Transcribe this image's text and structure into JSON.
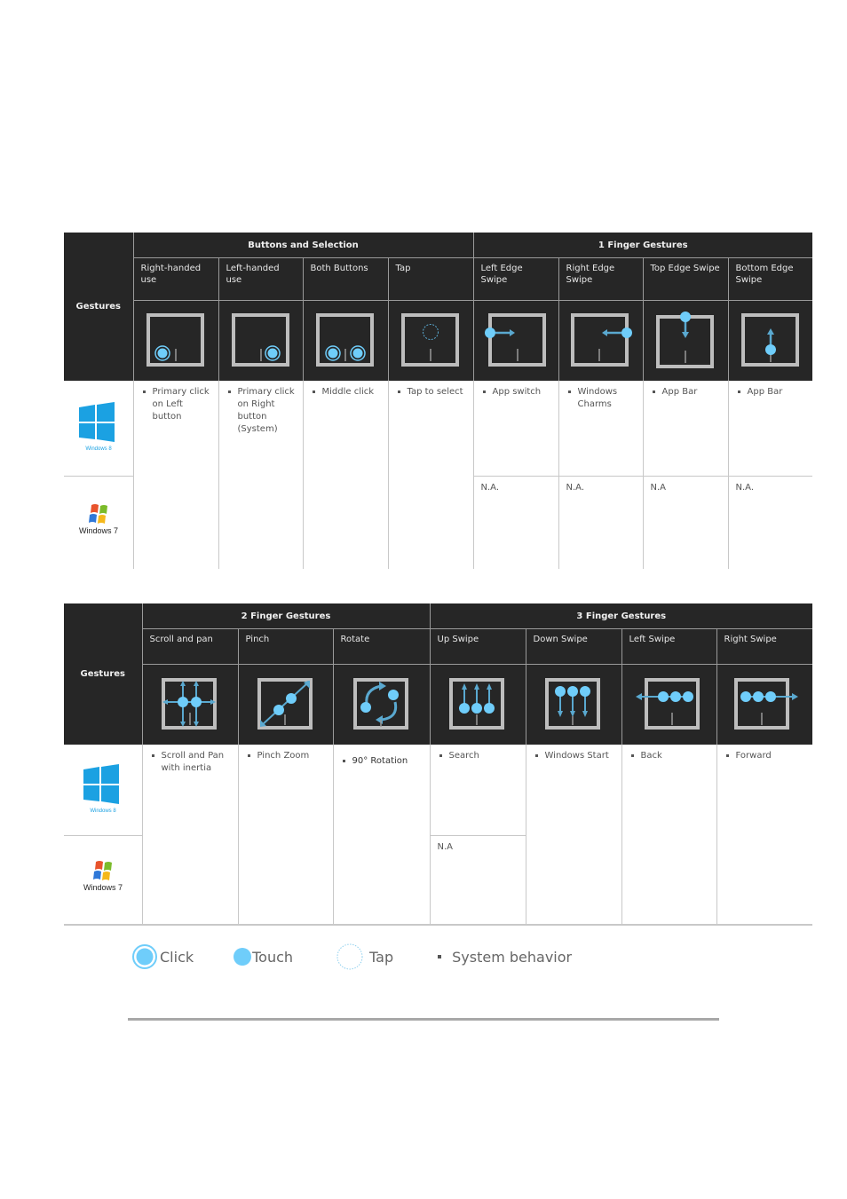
{
  "table1": {
    "row_label": "Gestures",
    "groups": [
      {
        "title": "Buttons and Selection",
        "span": 4
      },
      {
        "title": "1 Finger Gestures",
        "span": 4
      }
    ],
    "columns": [
      {
        "label": "Right-handed use",
        "icon": "right-handed-click-icon",
        "win8": "Primary click on Left button",
        "win7": null
      },
      {
        "label": "Left-handed use",
        "icon": "left-handed-click-icon",
        "win8": "Primary click on Right button (System)",
        "win7": null
      },
      {
        "label": "Both Buttons",
        "icon": "both-buttons-click-icon",
        "win8": "Middle click",
        "win7": null
      },
      {
        "label": "Tap",
        "icon": "tap-icon",
        "win8": "Tap to select",
        "win7": null
      },
      {
        "label": "Left Edge Swipe",
        "icon": "left-edge-swipe-icon",
        "win8": "App switch",
        "win7": "N.A."
      },
      {
        "label": "Right Edge Swipe",
        "icon": "right-edge-swipe-icon",
        "win8": "Windows Charms",
        "win7": "N.A."
      },
      {
        "label": "Top Edge Swipe",
        "icon": "top-edge-swipe-icon",
        "win8": "App Bar",
        "win7": "N.A"
      },
      {
        "label": "Bottom Edge Swipe",
        "icon": "bottom-edge-swipe-icon",
        "win8": "App Bar",
        "win7": "N.A."
      }
    ]
  },
  "table2": {
    "row_label": "Gestures",
    "groups": [
      {
        "title": "2 Finger Gestures",
        "span": 3
      },
      {
        "title": "3 Finger Gestures",
        "span": 4
      }
    ],
    "columns": [
      {
        "label": "Scroll and pan",
        "icon": "scroll-pan-icon",
        "win8": "Scroll and Pan with inertia",
        "win7": null
      },
      {
        "label": "Pinch",
        "icon": "pinch-icon",
        "win8": "Pinch Zoom",
        "win7": null
      },
      {
        "label": "Rotate",
        "icon": "rotate-icon",
        "win8": "90° Rotation",
        "win7": null
      },
      {
        "label": "Up Swipe",
        "icon": "three-finger-up-icon",
        "win8": "Search",
        "win7": "N.A"
      },
      {
        "label": "Down Swipe",
        "icon": "three-finger-down-icon",
        "win8": "Windows Start",
        "win7": null
      },
      {
        "label": "Left Swipe",
        "icon": "three-finger-left-icon",
        "win8": "Back",
        "win7": null
      },
      {
        "label": "Right Swipe",
        "icon": "three-finger-right-icon",
        "win8": "Forward",
        "win7": null
      }
    ]
  },
  "os": {
    "win8": {
      "name": "Windows 8",
      "color": "#1ba1e2"
    },
    "win7": {
      "name": "Windows 7"
    }
  },
  "legend": {
    "click": "Click",
    "touch": "Touch",
    "tap": "Tap",
    "system": "System behavior"
  },
  "colors": {
    "header_bg": "#262626",
    "touch_blue": "#6fcdfa",
    "arrow_blue": "#5aa9d0",
    "pad_border": "#bdbdbd"
  }
}
